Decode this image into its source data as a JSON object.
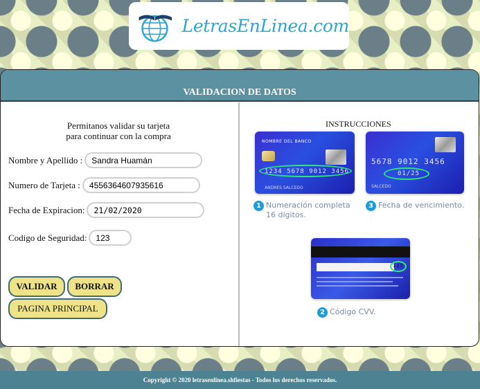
{
  "logo": {
    "text": "LetrasEnLinea.com"
  },
  "header": {
    "title": "VALIDACION DE DATOS"
  },
  "form": {
    "intro_line1": "Permitanos validar su tarjeta",
    "intro_line2": "para continuar con la compra",
    "name_label": "Nombre y Apellido :",
    "name_value": "Sandra Huamán",
    "card_label": "Numero de Tarjeta :",
    "card_value": "4556364607935616",
    "expiry_label": "Fecha de Expiracion:",
    "expiry_value": "21/02/2020",
    "cvv_label": "Codigo de Seguridad:",
    "cvv_value": "123"
  },
  "buttons": {
    "validate": "VALIDAR",
    "clear": "BORRAR",
    "home": "PAGINA PRINCIPAL"
  },
  "instructions": {
    "title": "INSTRUCCIONES",
    "card1": {
      "bank": "NOMBRE DEL BANCO",
      "number": "1234 5678 9012 3456",
      "holder": "ANDRES SALCEDO"
    },
    "card3": {
      "number": "5678 9012 3456",
      "expiry": "01/25",
      "holder": "SALCEDO"
    },
    "card2": {
      "cvv": "123"
    },
    "step1_num": "1",
    "step1_line1": "Numeración completa",
    "step1_line2": "16 dígitos.",
    "step3_num": "3",
    "step3_text": "Fecha de vencimiento.",
    "step2_num": "2",
    "step2_text": "Código CVV."
  },
  "footer": {
    "text": "Copyright © 2020 letrasenlinea.shfiestas - Todos los derechos reservados."
  },
  "colors": {
    "header_bg": "#5b91a1",
    "button_bg": "#efe38a",
    "footer_bg": "#4d8293",
    "brand": "#2aa6cf"
  }
}
